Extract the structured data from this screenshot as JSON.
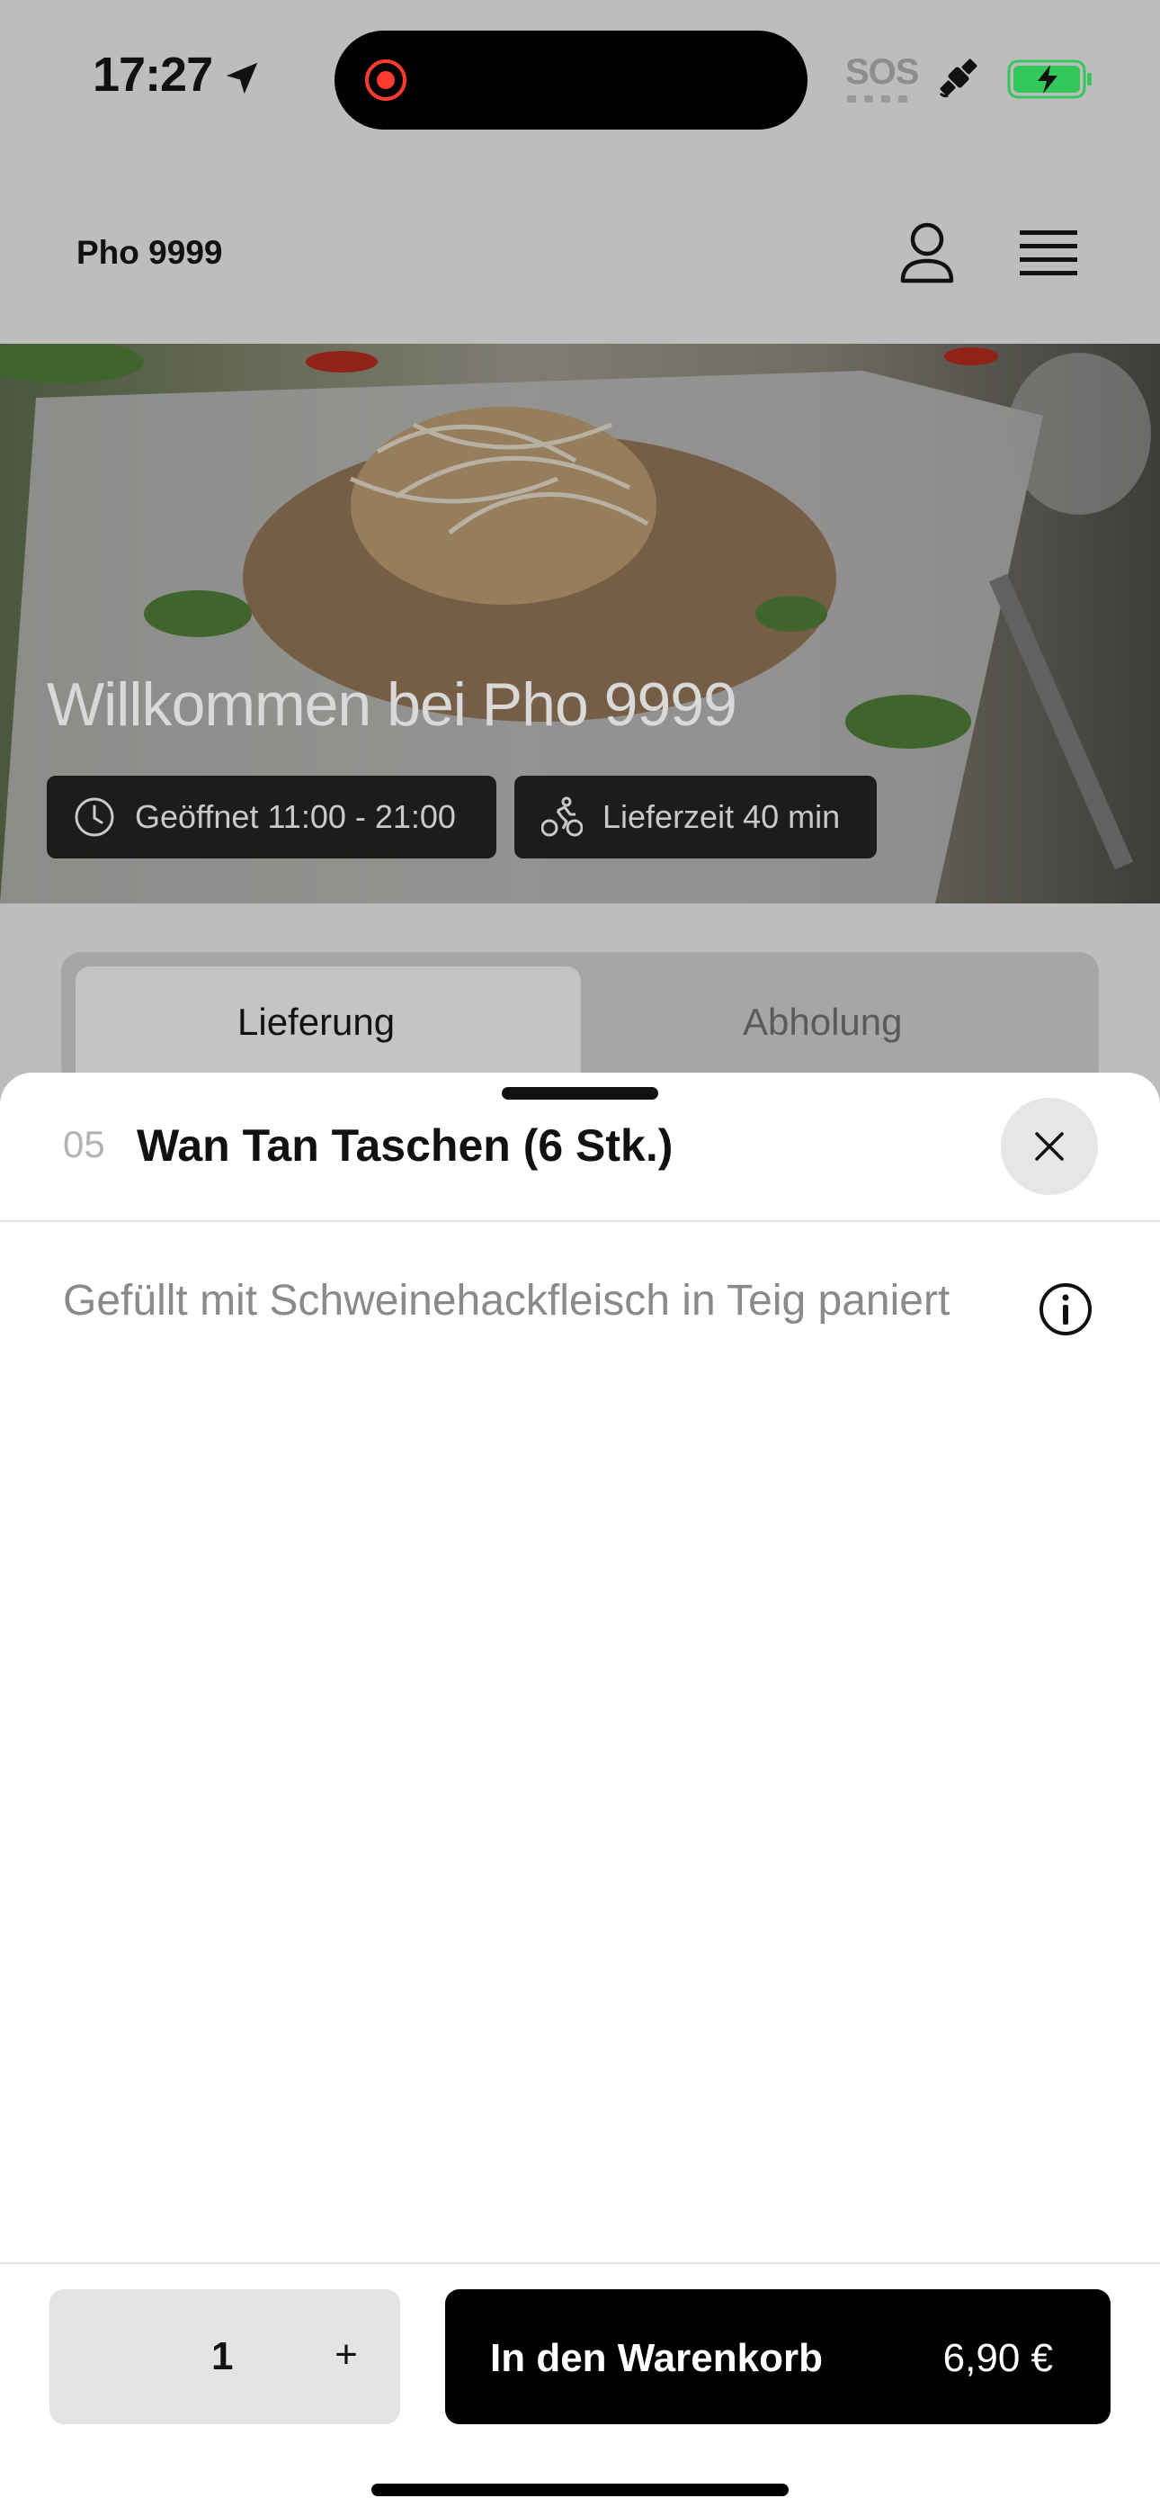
{
  "status_bar": {
    "time": "17:27",
    "sos": "SOS",
    "icons": [
      "location-arrow-icon",
      "recording-dot-icon",
      "satellite-icon",
      "battery-charging-icon"
    ]
  },
  "header": {
    "brand": "Pho 9999",
    "icons": [
      "user-icon",
      "hamburger-menu-icon"
    ]
  },
  "hero": {
    "title": "Willkommen bei Pho 9999",
    "opening": "Geöffnet 11:00 - 21:00",
    "delivery_time": "Lieferzeit 40 min"
  },
  "segment": {
    "options": [
      "Lieferung",
      "Abholung"
    ],
    "selected": "Lieferung"
  },
  "sheet": {
    "item_number": "05",
    "item_name": "Wan Tan Taschen (6 Stk.)",
    "description": "Gefüllt mit Schweinehackfleisch in Teig paniert",
    "quantity": "1",
    "plus_label": "+",
    "add_to_cart_label": "In den Warenkorb",
    "price": "6,90 €"
  },
  "colors": {
    "accent": "#000000",
    "dimmed_background": "#bdbdbd",
    "battery_green": "#34c759",
    "recording_red": "#ff3b30"
  }
}
